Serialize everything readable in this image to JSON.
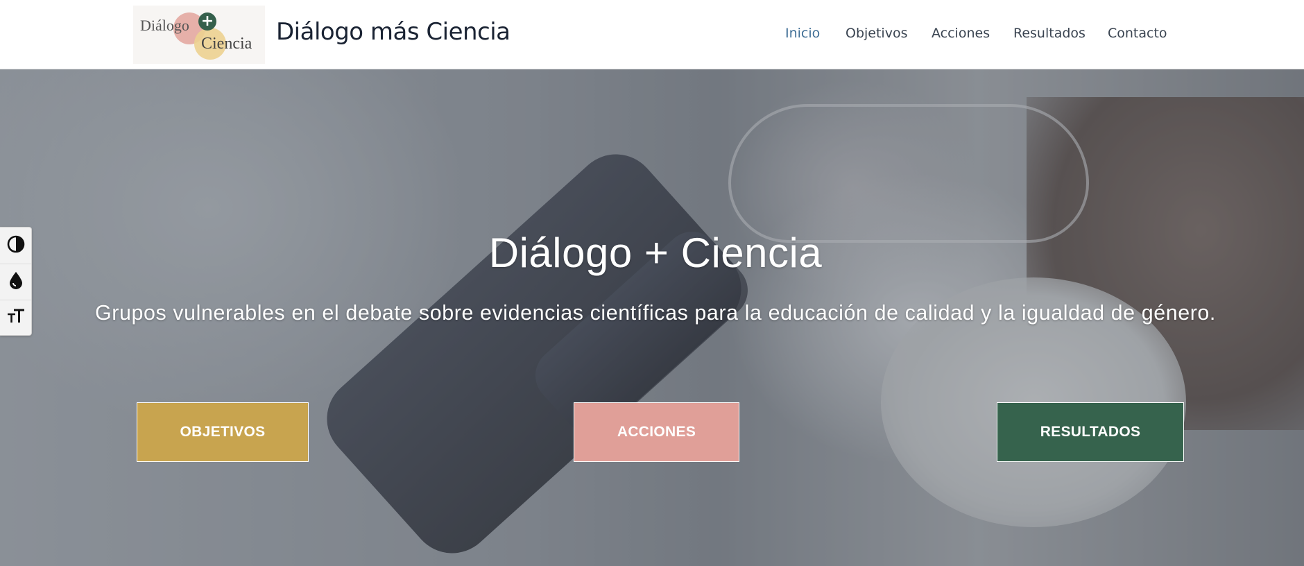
{
  "header": {
    "logo": {
      "line1": "Diálogo",
      "line2": "Ciencia",
      "plus": "+"
    },
    "site_title": "Diálogo más Ciencia",
    "nav": [
      {
        "label": "Inicio",
        "active": true
      },
      {
        "label": "Objetivos",
        "active": false
      },
      {
        "label": "Acciones",
        "active": false
      },
      {
        "label": "Resultados",
        "active": false
      },
      {
        "label": "Contacto",
        "active": false
      }
    ]
  },
  "hero": {
    "title": "Diálogo + Ciencia",
    "subtitle": "Grupos vulnerables en el debate sobre evidencias científicas para la educación de calidad y la igualdad de género.",
    "buttons": [
      {
        "label": "OBJETIVOS",
        "color": "#c8a44f"
      },
      {
        "label": "ACCIONES",
        "color": "#e09f98"
      },
      {
        "label": "RESULTADOS",
        "color": "#36634d"
      }
    ]
  },
  "accessibility_toolbar": {
    "tools": [
      {
        "icon": "contrast-icon"
      },
      {
        "icon": "drop-icon"
      },
      {
        "icon": "font-size-icon"
      }
    ]
  },
  "colors": {
    "nav_active": "#3f6e95",
    "nav_text": "#3a4451",
    "title_text": "#1a2333"
  }
}
